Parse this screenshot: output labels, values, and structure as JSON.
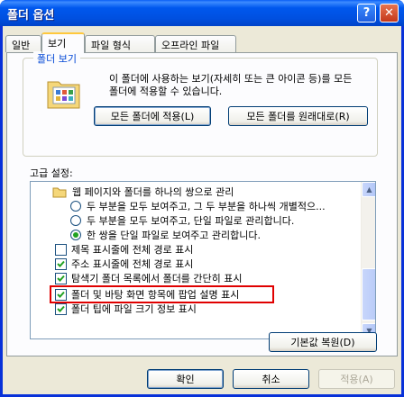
{
  "window": {
    "title": "폴더 옵션",
    "help_label": "?",
    "close_label": "✕"
  },
  "tabs": [
    "일반",
    "보기",
    "파일 형식",
    "오프라인 파일"
  ],
  "folder_views": {
    "group_label": "폴더 보기",
    "description": "이 폴더에 사용하는 보기(자세히 또는 큰 아이콘 등)를 모든 폴더에  적용할 수 있습니다.",
    "apply_button": "모든 폴더에 적용(L)",
    "reset_button": "모든 폴더를 원래대로(R)"
  },
  "advanced": {
    "label": "고급 설정:",
    "items": [
      {
        "type": "folder",
        "label": "웹 페이지와 폴더를 하나의 쌍으로 관리"
      },
      {
        "type": "radio",
        "checked": false,
        "label": "두 부분을 모두 보여주고, 그 두 부분을 하나씩 개별적으..."
      },
      {
        "type": "radio",
        "checked": false,
        "label": "두 부분을 모두 보여주고, 단일 파일로 관리합니다."
      },
      {
        "type": "radio",
        "checked": true,
        "label": "한 쌍을 단일 파일로 보여주고 관리합니다."
      },
      {
        "type": "checkbox",
        "checked": false,
        "label": "제목 표시줄에 전체 경로 표시"
      },
      {
        "type": "checkbox",
        "checked": true,
        "label": "주소 표시줄에 전체 경로 표시"
      },
      {
        "type": "checkbox",
        "checked": true,
        "label": "탐색기 폴더 목록에서 폴더를 간단히 표시"
      },
      {
        "type": "checkbox",
        "checked": true,
        "label": "폴더 및 바탕 화면 항목에 팝업 설명 표시"
      },
      {
        "type": "checkbox",
        "checked": true,
        "label": "폴더 팁에 파일 크기 정보 표시"
      }
    ],
    "restore_button": "기본값 복원(D)"
  },
  "dialog_buttons": {
    "ok": "확인",
    "cancel": "취소",
    "apply": "적용(A)"
  },
  "colors": {
    "title_bar": "#0058ee",
    "highlight_box": "#e00000",
    "check_mark": "#21a121"
  }
}
